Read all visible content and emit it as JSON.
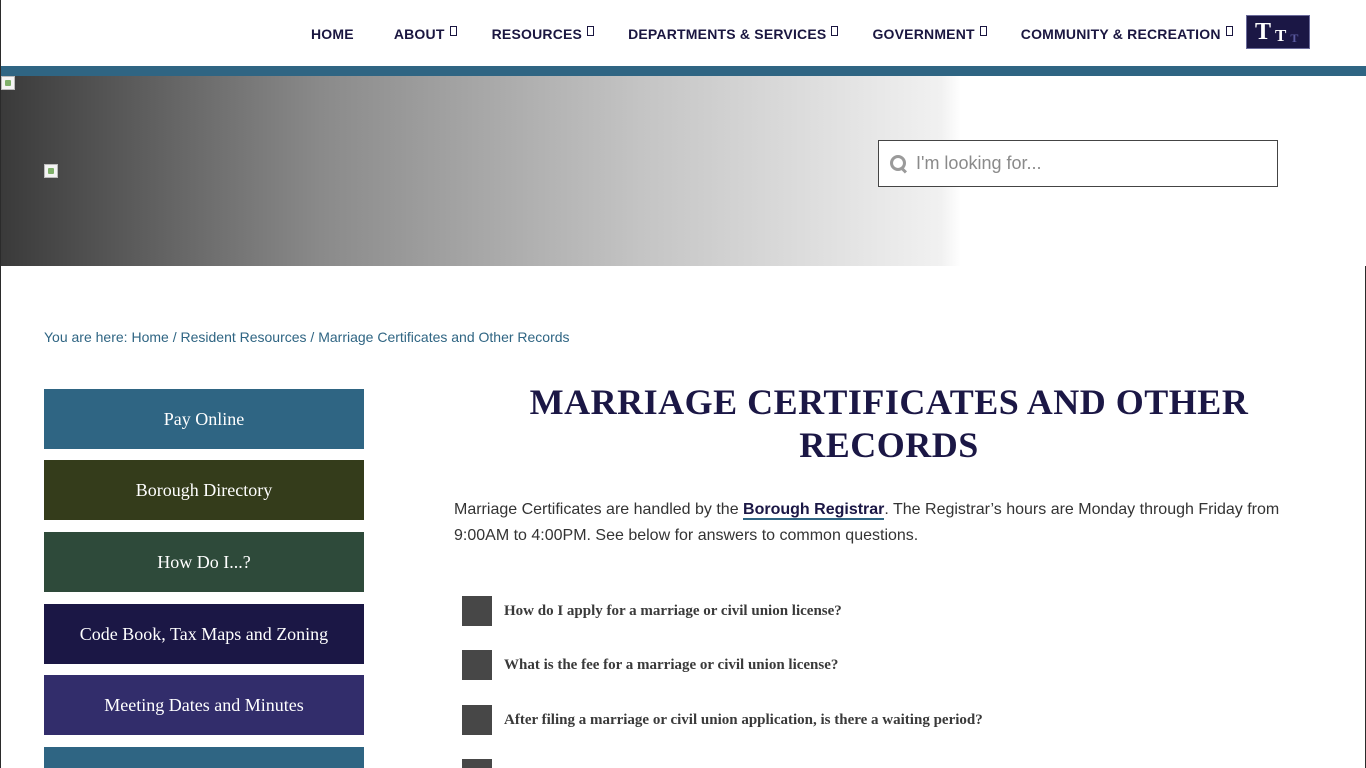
{
  "nav": {
    "items": [
      {
        "label": "HOME",
        "has_dropdown": false
      },
      {
        "label": "ABOUT",
        "has_dropdown": true
      },
      {
        "label": "RESOURCES",
        "has_dropdown": true
      },
      {
        "label": "DEPARTMENTS & SERVICES",
        "has_dropdown": true
      },
      {
        "label": "GOVERNMENT",
        "has_dropdown": true
      },
      {
        "label": "COMMUNITY & RECREATION",
        "has_dropdown": true
      }
    ],
    "logo": {
      "letters": [
        "T",
        "T",
        "T"
      ]
    }
  },
  "search": {
    "placeholder": "I'm looking for..."
  },
  "breadcrumb": {
    "prefix": "You are here: ",
    "items": [
      "Home",
      "Resident Resources",
      "Marriage Certificates and Other Records"
    ],
    "separator": " / "
  },
  "sidebar": {
    "buttons": [
      {
        "label": "Pay Online",
        "color": "#2f6583"
      },
      {
        "label": "Borough Directory",
        "color": "#343c1b"
      },
      {
        "label": "How Do I...?",
        "color": "#2e4a3a"
      },
      {
        "label": "Code Book, Tax Maps and Zoning",
        "color": "#1b1745"
      },
      {
        "label": "Meeting Dates and Minutes",
        "color": "#322d6b"
      },
      {
        "label": "",
        "color": "#2f6583"
      }
    ]
  },
  "main": {
    "title_line1": "MARRIAGE CERTIFICATES AND OTHER",
    "title_line2": "RECORDS",
    "intro": {
      "before_link": "Marriage Certificates are handled by the ",
      "link": "Borough Registrar",
      "after_link": ".  The Registrar’s hours are Monday through Friday from 9:00AM to 4:00PM.  See below for answers to common questions."
    },
    "faqs": [
      "How do I apply for a marriage or civil union license?",
      "What is the fee for a marriage or civil union license?",
      "After filing a marriage or civil union application, is there a waiting period?",
      ""
    ]
  },
  "colors": {
    "nav_text": "#1a1640",
    "strip": "#2f6583",
    "title": "#1b1745",
    "link": "#2f6583",
    "faq_box": "#474747"
  }
}
